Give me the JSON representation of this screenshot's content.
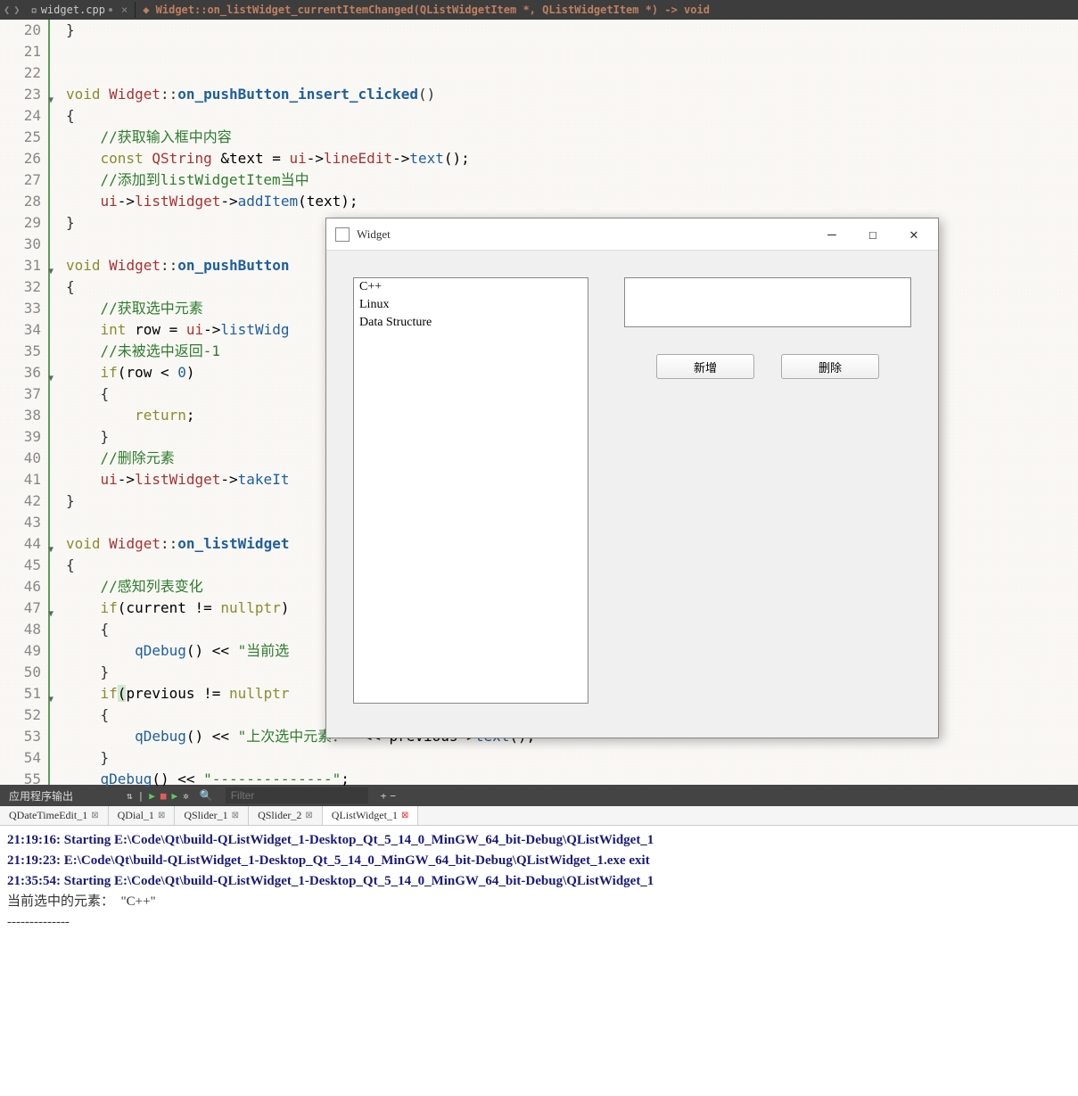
{
  "toolbar": {
    "file_name": "widget.cpp",
    "breadcrumb": "Widget::on_listWidget_currentItemChanged(QListWidgetItem *, QListWidgetItem *) -> void"
  },
  "gutter": {
    "start": 20,
    "end": 55,
    "folds": [
      23,
      31,
      36,
      44,
      47,
      51
    ]
  },
  "code": {
    "l20": "}",
    "l21": "",
    "l22": "",
    "l23_kw": "void",
    "l23_cls": "Widget",
    "l23_sep": "::",
    "l23_fn": "on_pushButton_insert_clicked",
    "l23_end": "()",
    "l24": "{",
    "l25_c": "//获取输入框中内容",
    "l26_kw": "const",
    "l26_type": "QString",
    "l26_rest": " &text = ",
    "l26_mem": "ui",
    "l26_arrow": "->",
    "l26_m2": "lineEdit",
    "l26_a2": "->",
    "l26_call": "text",
    "l26_end": "();",
    "l27_c": "//添加到listWidgetItem当中",
    "l28_m": "ui",
    "l28_a": "->",
    "l28_m2": "listWidget",
    "l28_a2": "->",
    "l28_call": "addItem",
    "l28_args": "(text);",
    "l29": "}",
    "l30": "",
    "l31_kw": "void",
    "l31_cls": "Widget",
    "l31_sep": "::",
    "l31_fn": "on_pushButton",
    "l32": "{",
    "l33_c": "//获取选中元素",
    "l34_kw": "int",
    "l34_var": " row = ",
    "l34_m": "ui",
    "l34_a": "->",
    "l34_call": "listWidg",
    "l35_c": "//未被选中返回-1",
    "l36_kw": "if",
    "l36_rest": "(row < ",
    "l36_num": "0",
    "l36_end": ")",
    "l37": "{",
    "l38_kw": "return",
    "l38_end": ";",
    "l39": "}",
    "l40_c": "//删除元素",
    "l41_m": "ui",
    "l41_a": "->",
    "l41_m2": "listWidget",
    "l41_a2": "->",
    "l41_call": "takeIt",
    "l42": "}",
    "l43": "",
    "l44_kw": "void",
    "l44_cls": "Widget",
    "l44_sep": "::",
    "l44_fn": "on_listWidget",
    "l45": "{",
    "l46_c": "//感知列表变化",
    "l47_kw": "if",
    "l47_rest": "(current != ",
    "l47_null": "nullptr",
    "l47_end": ")",
    "l48": "{",
    "l49_call": "qDebug",
    "l49_rest": "() << ",
    "l49_str": "\"当前选",
    "l50": "}",
    "l51_kw": "if",
    "l51_p1": "(",
    "l51_rest": "previous != ",
    "l51_null": "nullptr",
    "l52": "{",
    "l53_call": "qDebug",
    "l53_rest": "() << ",
    "l53_str": "\"上次选中元素：\"",
    "l53_rest2": " << previous->",
    "l53_call2": "text",
    "l53_end": "();",
    "l54": "}",
    "l55_call": "qDebug",
    "l55_rest": "() << ",
    "l55_str": "\"--------------\"",
    "l55_end": ";"
  },
  "widget": {
    "title": "Widget",
    "list_items": [
      "C++",
      "Linux",
      "Data Structure"
    ],
    "btn_add": "新增",
    "btn_del": "删除"
  },
  "output": {
    "title": "应用程序输出",
    "filter_placeholder": "Filter",
    "tabs": [
      {
        "label": "QDateTimeEdit_1",
        "active": false
      },
      {
        "label": "QDial_1",
        "active": false
      },
      {
        "label": "QSlider_1",
        "active": false
      },
      {
        "label": "QSlider_2",
        "active": false
      },
      {
        "label": "QListWidget_1",
        "active": true
      }
    ],
    "lines": [
      {
        "bold": true,
        "text": "21:19:16: Starting E:\\Code\\Qt\\build-QListWidget_1-Desktop_Qt_5_14_0_MinGW_64_bit-Debug\\QListWidget_1"
      },
      {
        "bold": true,
        "text": "21:19:23: E:\\Code\\Qt\\build-QListWidget_1-Desktop_Qt_5_14_0_MinGW_64_bit-Debug\\QListWidget_1.exe exit"
      },
      {
        "bold": false,
        "text": ""
      },
      {
        "bold": true,
        "text": "21:35:54: Starting E:\\Code\\Qt\\build-QListWidget_1-Desktop_Qt_5_14_0_MinGW_64_bit-Debug\\QListWidget_1"
      },
      {
        "bold": false,
        "text": "当前选中的元素：  \"C++\""
      },
      {
        "bold": false,
        "text": "--------------"
      }
    ]
  }
}
